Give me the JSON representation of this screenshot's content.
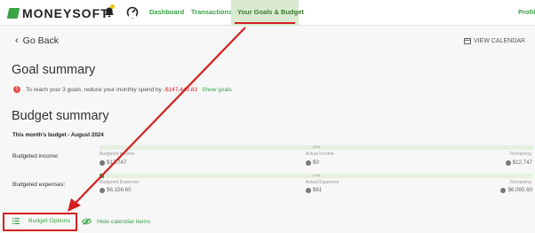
{
  "nav": {
    "brand": "MONEYSOFT",
    "links": [
      "Dashboard",
      "Transactions"
    ],
    "active": "Your Goals & Budget",
    "profile": "Profil"
  },
  "header": {
    "back": "Go Back",
    "view_calendar": "VIEW CALENDAR"
  },
  "goal": {
    "title": "Goal summary",
    "message": "To reach your 3 goals, reduce your monthly spend by",
    "amount": "-$147,440.83",
    "link": "Show goals"
  },
  "budget": {
    "title": "Budget summary",
    "month": "This month's budget - August 2024",
    "income": {
      "label": "Budgeted income:",
      "percent": "(0%)",
      "fill": 0,
      "budgeted_label": "Budgeted Income",
      "budgeted_value": "$12,747",
      "actual_label": "Actual Income",
      "actual_value": "$0",
      "remaining_label": "Remaining",
      "remaining_value": "$12,747"
    },
    "expenses": {
      "label": "Budgeted expenses:",
      "percent": "(1%)",
      "fill": 0.01,
      "budgeted_label": "Budgeted Expenses",
      "budgeted_value": "$6,156.60",
      "actual_label": "Actual Expenses",
      "actual_value": "$61",
      "remaining_label": "Remaining",
      "remaining_value": "$6,095.60"
    }
  },
  "footer": {
    "budget_options": "Budget Options",
    "hide_calendar": "Hide calendar items"
  },
  "colors": {
    "accent": "#3aa346",
    "annotation": "#d42020"
  }
}
